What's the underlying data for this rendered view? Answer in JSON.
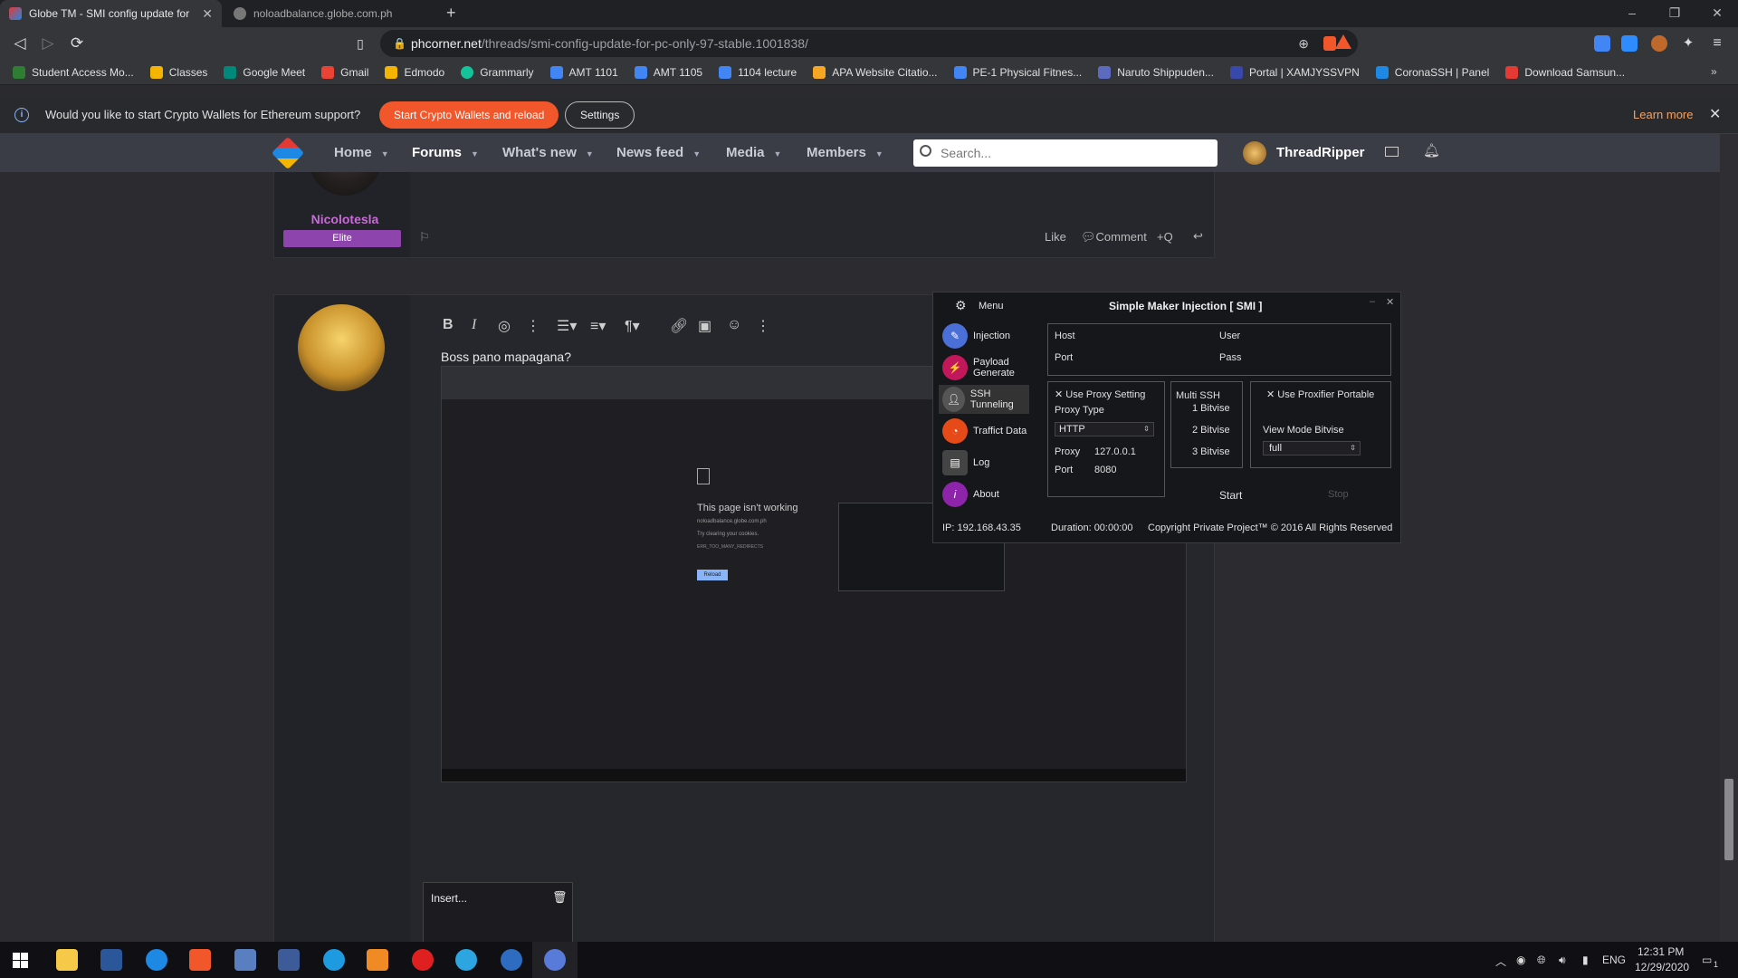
{
  "browser": {
    "tabs": [
      {
        "label": "Globe TM - SMI config update for",
        "active": true
      },
      {
        "label": "noloadbalance.globe.com.ph",
        "active": false
      }
    ],
    "url": {
      "domain": "phcorner.net",
      "path": "/threads/smi-config-update-for-pc-only-97-stable.1001838/"
    },
    "bookmarks": [
      {
        "label": "Student Access Mo...",
        "color": "#2e7d32"
      },
      {
        "label": "Classes",
        "color": "#f4b400"
      },
      {
        "label": "Google Meet",
        "color": "#00897b"
      },
      {
        "label": "Gmail",
        "color": "#ea4335"
      },
      {
        "label": "Edmodo",
        "color": "#f4b400"
      },
      {
        "label": "Grammarly",
        "color": "#15c39a"
      },
      {
        "label": "AMT 1101",
        "color": "#4285f4"
      },
      {
        "label": "AMT 1105",
        "color": "#4285f4"
      },
      {
        "label": "1104 lecture",
        "color": "#4285f4"
      },
      {
        "label": "APA Website Citatio...",
        "color": "#f6a623"
      },
      {
        "label": "PE-1 Physical Fitnes...",
        "color": "#4285f4"
      },
      {
        "label": "Naruto Shippuden...",
        "color": "#5c6bc0"
      },
      {
        "label": "Portal | XAMJYSSVPN",
        "color": "#3949ab"
      },
      {
        "label": "CoronaSSH | Panel",
        "color": "#1e88e5"
      },
      {
        "label": "Download Samsun...",
        "color": "#e53935"
      }
    ]
  },
  "infobar": {
    "message": "Would you like to start Crypto Wallets for Ethereum support?",
    "primary_button": "Start Crypto Wallets and reload",
    "secondary_button": "Settings",
    "learn_more": "Learn more"
  },
  "forum_nav": {
    "items": [
      "Home",
      "Forums",
      "What's new",
      "News feed",
      "Media",
      "Members"
    ],
    "active": "Forums",
    "search_placeholder": "Search...",
    "username": "ThreadRipper"
  },
  "post_prev": {
    "author": "Nicolotesla",
    "badge": "Elite",
    "actions": {
      "like": "Like",
      "comment": "Comment",
      "quote": "+Q"
    }
  },
  "editor": {
    "text": "Boss pano mapagana?",
    "attachment_label": "Insert...",
    "embedded_error_title": "This page isn't working",
    "embedded_error_domain": "noloadbalance.globe.com.ph",
    "embedded_error_hint": "Try clearing your cookies.",
    "embedded_error_code": "ERR_TOO_MANY_REDIRECTS",
    "embedded_reload": "Reload"
  },
  "smi": {
    "menu_label": "Menu",
    "title": "Simple Maker Injection [ SMI ]",
    "menu": [
      {
        "label": "Injection",
        "icon": "syringe-icon",
        "color": "#4a6fd6"
      },
      {
        "label": "Payload Generate",
        "icon": "payload-icon",
        "color": "#c2185b"
      },
      {
        "label": "SSH Tunneling",
        "icon": "user-icon",
        "color": "#555"
      },
      {
        "label": "Traffict Data",
        "icon": "gauge-icon",
        "color": "#e64a19"
      },
      {
        "label": "Log",
        "icon": "log-icon",
        "color": "#444"
      },
      {
        "label": "About",
        "icon": "info-icon",
        "color": "#8e24aa"
      }
    ],
    "host_label": "Host",
    "port_label": "Port",
    "user_label": "User",
    "pass_label": "Pass",
    "use_proxy": "Use Proxy Setting",
    "proxy_type_label": "Proxy Type",
    "proxy_type_value": "HTTP",
    "proxy_label": "Proxy",
    "proxy_value": "127.0.0.1",
    "port2_label": "Port",
    "port2_value": "8080",
    "multi_ssh": "Multi SSH",
    "bitvise": [
      "1 Bitvise",
      "2 Bitvise",
      "3 Bitvise"
    ],
    "use_proxifier": "Use Proxifier Portable",
    "view_mode_label": "View Mode Bitvise",
    "view_mode_value": "full",
    "start": "Start",
    "stop": "Stop",
    "ip": "IP: 192.168.43.35",
    "duration": "Duration: 00:00:00",
    "copyright": "Copyright Private Project™ © 2016  All Rights Reserved"
  },
  "taskbar": {
    "lang": "ENG",
    "time": "12:31 PM",
    "date": "12/29/2020",
    "notif_count": "1"
  }
}
